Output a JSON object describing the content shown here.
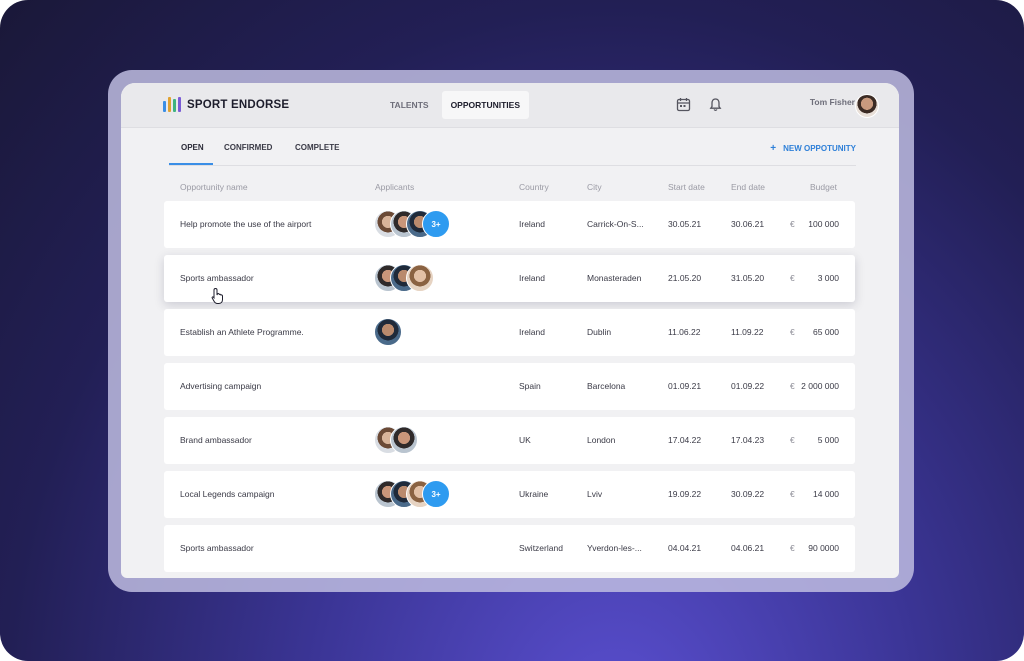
{
  "app": {
    "name": "SPORT ENDORSE"
  },
  "nav": {
    "tabs": [
      "TALENTS",
      "OPPORTUNITIES"
    ],
    "active": "OPPORTUNITIES"
  },
  "header_icons": [
    "calendar-icon",
    "bell-icon"
  ],
  "user": {
    "name": "Tom Fisher"
  },
  "subtabs": {
    "items": [
      "OPEN",
      "CONFIRMED",
      "COMPLETE"
    ],
    "active": "OPEN"
  },
  "new_opportunity": {
    "label": "NEW OPPOTUNITY",
    "icon": "+"
  },
  "table": {
    "headers": [
      "Opportunity name",
      "Applicants",
      "Country",
      "City",
      "Start date",
      "End date",
      "Budget"
    ],
    "currency": "€",
    "rows": [
      {
        "name": "Help promote the use of the airport",
        "applicants": 3,
        "more": "3+",
        "country": "Ireland",
        "city": "Carrick-On-S...",
        "start": "30.05.21",
        "end": "30.06.21",
        "budget": "100 000"
      },
      {
        "name": "Sports ambassador",
        "applicants": 3,
        "more": "",
        "country": "Ireland",
        "city": "Monasteraden",
        "start": "21.05.20",
        "end": "31.05.20",
        "budget": "3 000"
      },
      {
        "name": "Establish an Athlete Programme.",
        "applicants": 1,
        "more": "",
        "country": "Ireland",
        "city": "Dublin",
        "start": "11.06.22",
        "end": "11.09.22",
        "budget": "65 000"
      },
      {
        "name": "Advertising campaign",
        "applicants": 0,
        "more": "",
        "country": "Spain",
        "city": "Barcelona",
        "start": "01.09.21",
        "end": "01.09.22",
        "budget": "2 000 000"
      },
      {
        "name": "Brand ambassador",
        "applicants": 2,
        "more": "",
        "country": "UK",
        "city": "London",
        "start": "17.04.22",
        "end": "17.04.23",
        "budget": "5 000"
      },
      {
        "name": "Local Legends campaign",
        "applicants": 3,
        "more": "3+",
        "country": "Ukraine",
        "city": "Lviv",
        "start": "19.09.22",
        "end": "30.09.22",
        "budget": "14 000"
      },
      {
        "name": "Sports ambassador",
        "applicants": 0,
        "more": "",
        "country": "Switzerland",
        "city": "Yverdon-les-...",
        "start": "04.04.21",
        "end": "04.06.21",
        "budget": "90 0000"
      }
    ]
  },
  "colors": {
    "accent": "#2f80d8",
    "badge": "#2e9bf0",
    "logo_bars": [
      "#3a8ee6",
      "#e0a232",
      "#3fb37f",
      "#7a5cd6",
      "#d8504a"
    ]
  }
}
